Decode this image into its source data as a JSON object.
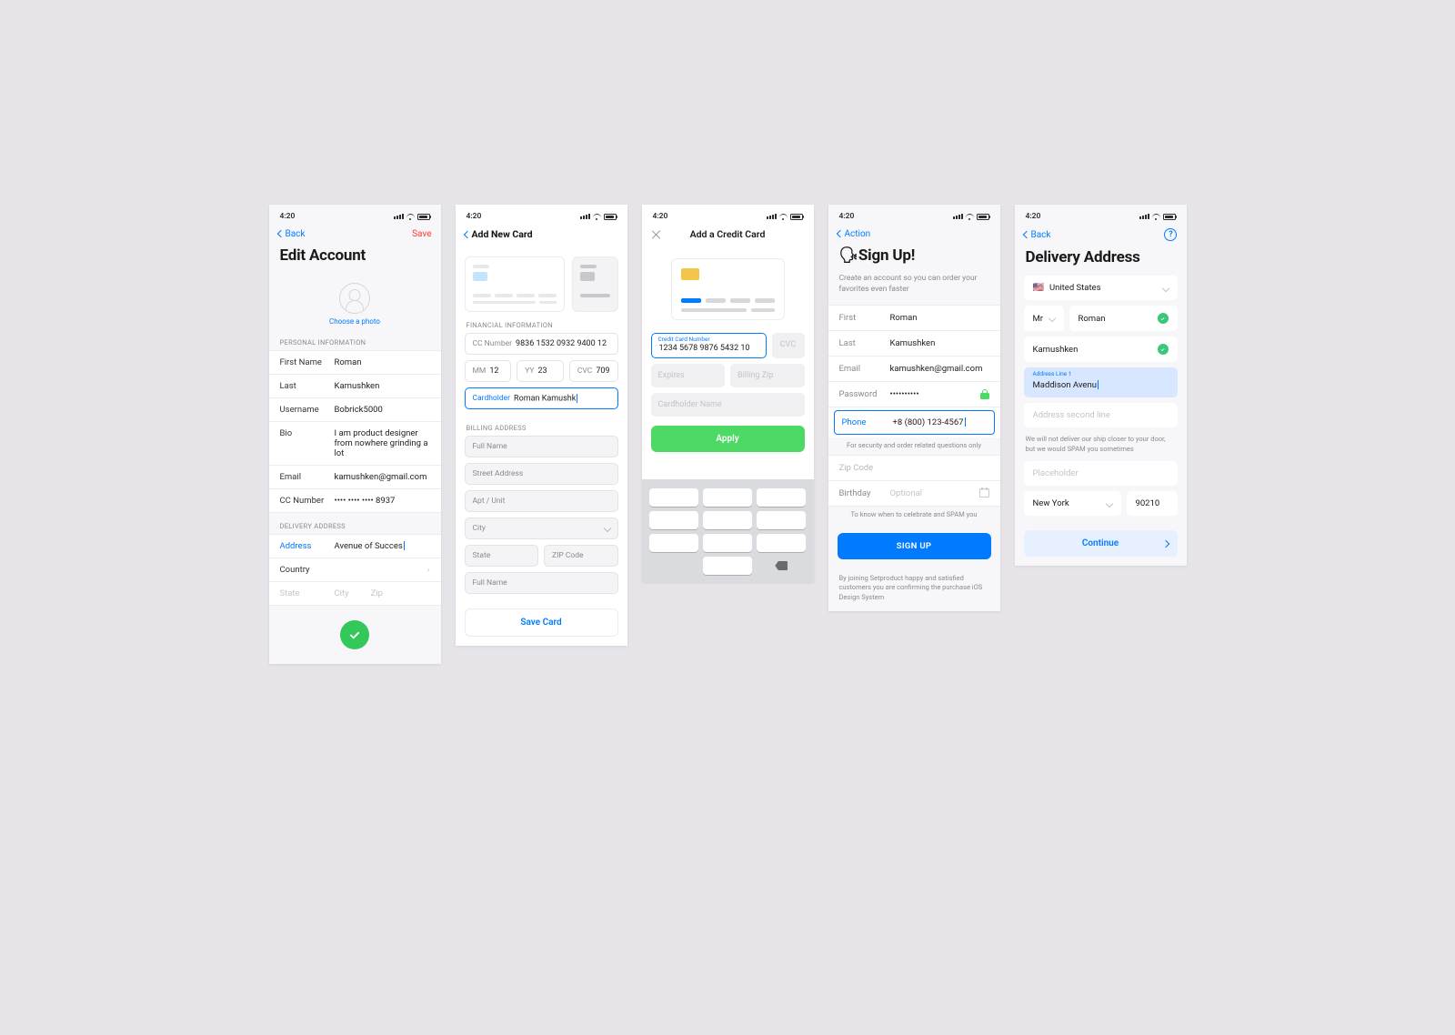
{
  "status_time": "4:20",
  "s1": {
    "back": "Back",
    "save": "Save",
    "title": "Edit Account",
    "choose_photo": "Choose a photo",
    "sec_personal": "Personal Information",
    "first_l": "First Name",
    "first_v": "Roman",
    "last_l": "Last",
    "last_v": "Kamushken",
    "user_l": "Username",
    "user_v": "Bobrick5000",
    "bio_l": "Bio",
    "bio_v": "I am product designer from nowhere grinding a lot",
    "email_l": "Email",
    "email_v": "kamushken@gmail.com",
    "cc_l": "CC Number",
    "cc_v": "•••• •••• •••• 8937",
    "sec_delivery": "Delivery Address",
    "addr_l": "Address",
    "addr_v": "Avenue of Succes",
    "country_l": "Country",
    "state_l": "State",
    "city_l": "City",
    "zip_l": "Zip"
  },
  "s2": {
    "title": "Add New Card",
    "sec_fin": "Financial Information",
    "cc_l": "CC Number",
    "cc_v": "9836 1532 0932 9400 12",
    "mm_l": "MM",
    "mm_v": "12",
    "yy_l": "YY",
    "yy_v": "23",
    "cvc_l": "CVC",
    "cvc_v": "709",
    "holder_l": "Cardholder",
    "holder_v": "Roman Kamushk",
    "sec_bill": "Billing Address",
    "full": "Full Name",
    "street": "Street Address",
    "apt": "Apt / Unit",
    "city": "City",
    "state": "State",
    "zip": "ZIP Code",
    "full2": "Full Name",
    "save": "Save Card"
  },
  "s3": {
    "title": "Add a Credit Card",
    "cc_l": "Credit Card Number",
    "cc_v": "1234 5678 9876 5432 10",
    "cvc": "CVC",
    "exp": "Expires",
    "zip": "Billing Zip",
    "holder": "Cardholder Name",
    "apply": "Apply"
  },
  "s4": {
    "back": "Action",
    "emoji": "🗣",
    "title": "Sign Up!",
    "sub": "Create an account so you can order your favorites even faster",
    "first_l": "First",
    "first_v": "Roman",
    "last_l": "Last",
    "last_v": "Kamushken",
    "email_l": "Email",
    "email_v": "kamushken@gmail.com",
    "pw_l": "Password",
    "pw_v": "••••••••••",
    "phone_l": "Phone",
    "phone_v": "+8 (800) 123-4567",
    "phone_hint": "For security and order related questions only",
    "zip_l": "Zip Code",
    "bday_l": "Birthday",
    "bday_v": "Optional",
    "bday_hint": "To know when to celebrate and SPAM you",
    "signup": "Sign Up",
    "terms": "By joining Setproduct happy and satisfied customers you are confirming the purchase iOS Design System"
  },
  "s5": {
    "back": "Back",
    "title": "Delivery Address",
    "country": "United States",
    "flag": "🇺🇸",
    "sal": "Mr",
    "first": "Roman",
    "last": "Kamushken",
    "addr1_l": "Address Line 1",
    "addr1_v": "Maddison Avenu",
    "addr2": "Address second line",
    "note": "We will not deliver our ship closer to your door, but we would SPAM you sometimes",
    "placeholder": "Placeholder",
    "city": "New York",
    "zip": "90210",
    "continue": "Continue"
  }
}
